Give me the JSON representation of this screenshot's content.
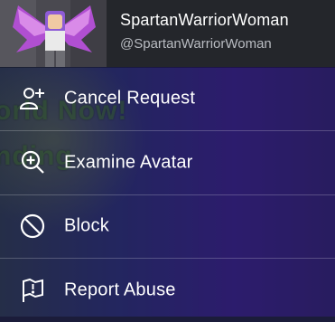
{
  "profile": {
    "display_name": "SpartanWarriorWoman",
    "username": "@SpartanWarriorWoman"
  },
  "background_text": {
    "line1": "orld Now!",
    "line2": "nding"
  },
  "menu": {
    "items": [
      {
        "label": "Cancel Request",
        "icon": "add-friend-icon"
      },
      {
        "label": "Examine Avatar",
        "icon": "zoom-in-icon"
      },
      {
        "label": "Block",
        "icon": "block-icon"
      },
      {
        "label": "Report Abuse",
        "icon": "report-flag-icon"
      }
    ]
  },
  "colors": {
    "header_bg": "#24262b",
    "text": "#ffffff",
    "subtext": "#b9bcc2"
  }
}
